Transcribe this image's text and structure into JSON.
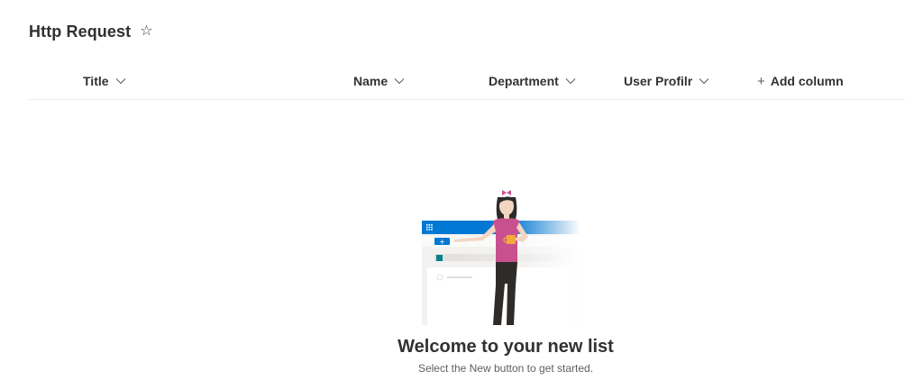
{
  "list": {
    "title": "Http Request",
    "favorite_icon": "star-outline-icon"
  },
  "columns": [
    {
      "label": "Title",
      "icon": "chevron-down-icon"
    },
    {
      "label": "Name",
      "icon": "chevron-down-icon"
    },
    {
      "label": "Department",
      "icon": "chevron-down-icon"
    },
    {
      "label": "User Profilr",
      "icon": "chevron-down-icon"
    }
  ],
  "add_column": {
    "icon": "plus-icon",
    "label": "Add column"
  },
  "empty_state": {
    "title": "Welcome to your new list",
    "subtitle": "Select the New button to get started."
  },
  "colors": {
    "accent": "#0078d4",
    "teal": "#038387",
    "shirt": "#c9508e",
    "text": "#323130",
    "muted": "#605e5c",
    "divider": "#edebe9"
  }
}
